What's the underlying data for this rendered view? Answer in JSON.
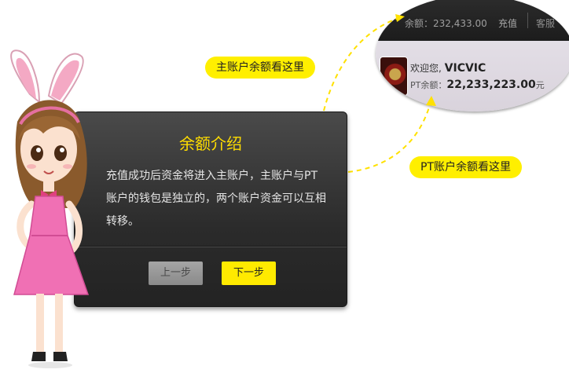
{
  "magnifier": {
    "balance_text": "余额：232,433.00",
    "recharge_label": "充值",
    "service_label": "客服",
    "welcome_prefix": "欢迎您,",
    "username": "VICVIC",
    "pt_label": "PT余额：",
    "pt_value": "22,233,223.00",
    "pt_unit": "元"
  },
  "tags": {
    "main_account": "主账户余额看这里",
    "pt_account": "PT账户余额看这里"
  },
  "dialog": {
    "title": "余额介绍",
    "body": "充值成功后资金将进入主账户，主账户与PT账户的钱包是独立的，两个账户资金可以互相转移。",
    "prev_label": "上一步",
    "next_label": "下一步"
  },
  "colors": {
    "accent_yellow": "#ffef00",
    "title_yellow": "#ffdd00",
    "dialog_dark": "#2b2b2b"
  },
  "icons": {
    "avatar": "iron-man-avatar",
    "character": "bunny-girl-mascot"
  }
}
